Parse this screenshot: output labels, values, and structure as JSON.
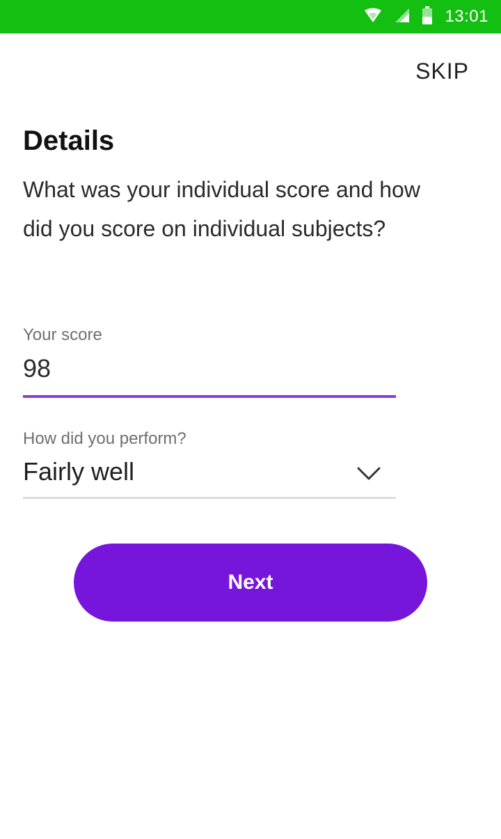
{
  "status_bar": {
    "time": "13:01",
    "background": "#13bf10",
    "icons": [
      "wifi-icon",
      "cell-signal-icon",
      "battery-icon"
    ]
  },
  "header": {
    "skip_label": "SKIP"
  },
  "main": {
    "title": "Details",
    "question": "What was your individual score and how did you score on individual subjects?",
    "score_field": {
      "label": "Your score",
      "value": "98",
      "underline_color": "#8a3ddc"
    },
    "performance_field": {
      "label": "How did you perform?",
      "value": "Fairly well",
      "icon": "chevron-down-icon"
    },
    "next_button": {
      "label": "Next",
      "color": "#7616db"
    }
  }
}
